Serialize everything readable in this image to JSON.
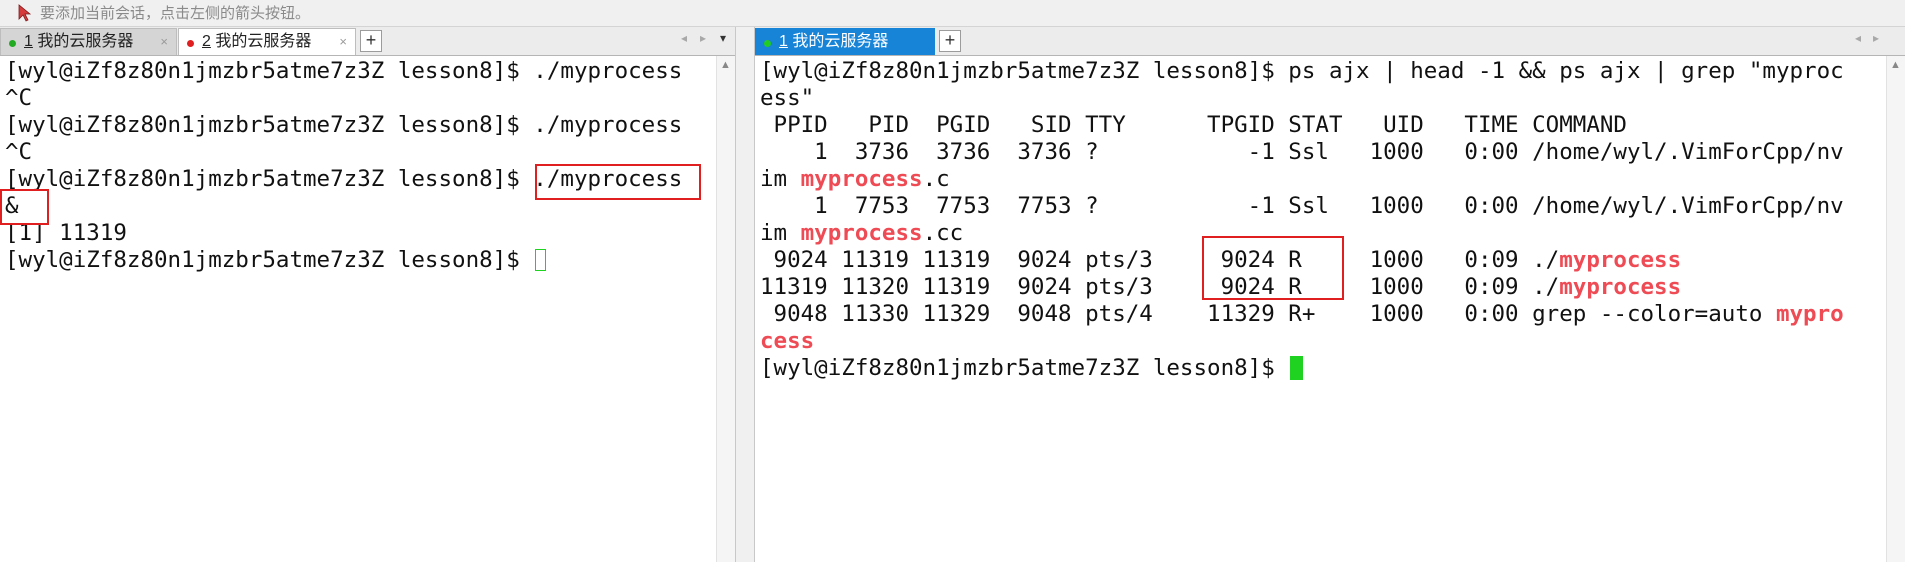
{
  "hint_bar": {
    "icon": "arrow-pointer-icon",
    "text": "要添加当前会话，点击左侧的箭头按钮。"
  },
  "left": {
    "tabs": [
      {
        "num": "1",
        "label": "我的云服务器",
        "dot_color": "#22aa22",
        "close": "×"
      },
      {
        "num": "2",
        "label": "我的云服务器",
        "dot_color": "#e02020",
        "close": "×"
      }
    ],
    "add": "+",
    "nav": [
      "◂",
      "▸",
      "▾"
    ],
    "lines": [
      "[wyl@iZf8z80n1jmzbr5atme7z3Z lesson8]$ ./myprocess",
      "^C",
      "[wyl@iZf8z80n1jmzbr5atme7z3Z lesson8]$ ./myprocess",
      "^C",
      "[wyl@iZf8z80n1jmzbr5atme7z3Z lesson8]$ ./myprocess",
      "&",
      "[1] 11319",
      "[wyl@iZf8z80n1jmzbr5atme7z3Z lesson8]$ "
    ]
  },
  "right": {
    "tab": {
      "num": "1",
      "label": "我的云服务器",
      "dot_color": "#22cc22"
    },
    "add": "+",
    "nav": [
      "◂",
      "▸"
    ],
    "lines": [
      {
        "pre": "[wyl@iZf8z80n1jmzbr5atme7z3Z lesson8]$ ps ajx | head -1 && ps ajx | grep \"myproc",
        "hl": "",
        "post": ""
      },
      {
        "pre": "ess\"",
        "hl": "",
        "post": ""
      },
      {
        "pre": " PPID   PID  PGID   SID TTY      TPGID STAT   UID   TIME COMMAND",
        "hl": "",
        "post": ""
      },
      {
        "pre": "    1  3736  3736  3736 ?           -1 Ssl   1000   0:00 /home/wyl/.VimForCpp/nv",
        "hl": "",
        "post": ""
      },
      {
        "pre": "im ",
        "hl": "myprocess",
        "post": ".c"
      },
      {
        "pre": "    1  7753  7753  7753 ?           -1 Ssl   1000   0:00 /home/wyl/.VimForCpp/nv",
        "hl": "",
        "post": ""
      },
      {
        "pre": "im ",
        "hl": "myprocess",
        "post": ".cc"
      },
      {
        "pre": " 9024 11319 11319  9024 pts/3     9024 R     1000   0:09 ./",
        "hl": "myprocess",
        "post": ""
      },
      {
        "pre": "11319 11320 11319  9024 pts/3     9024 R     1000   0:09 ./",
        "hl": "myprocess",
        "post": ""
      },
      {
        "pre": " 9048 11330 11329  9048 pts/4    11329 R+    1000   0:00 grep --color=auto ",
        "hl": "mypro",
        "post": ""
      },
      {
        "pre": "",
        "hl": "cess",
        "post": ""
      },
      {
        "pre": "[wyl@iZf8z80n1jmzbr5atme7z3Z lesson8]$ ",
        "hl": "",
        "post": ""
      }
    ]
  },
  "colors": {
    "highlight": "#ee4b55",
    "cursor": "#1fd120",
    "annotation": "#e02020",
    "active_tab": "#1784d8"
  }
}
